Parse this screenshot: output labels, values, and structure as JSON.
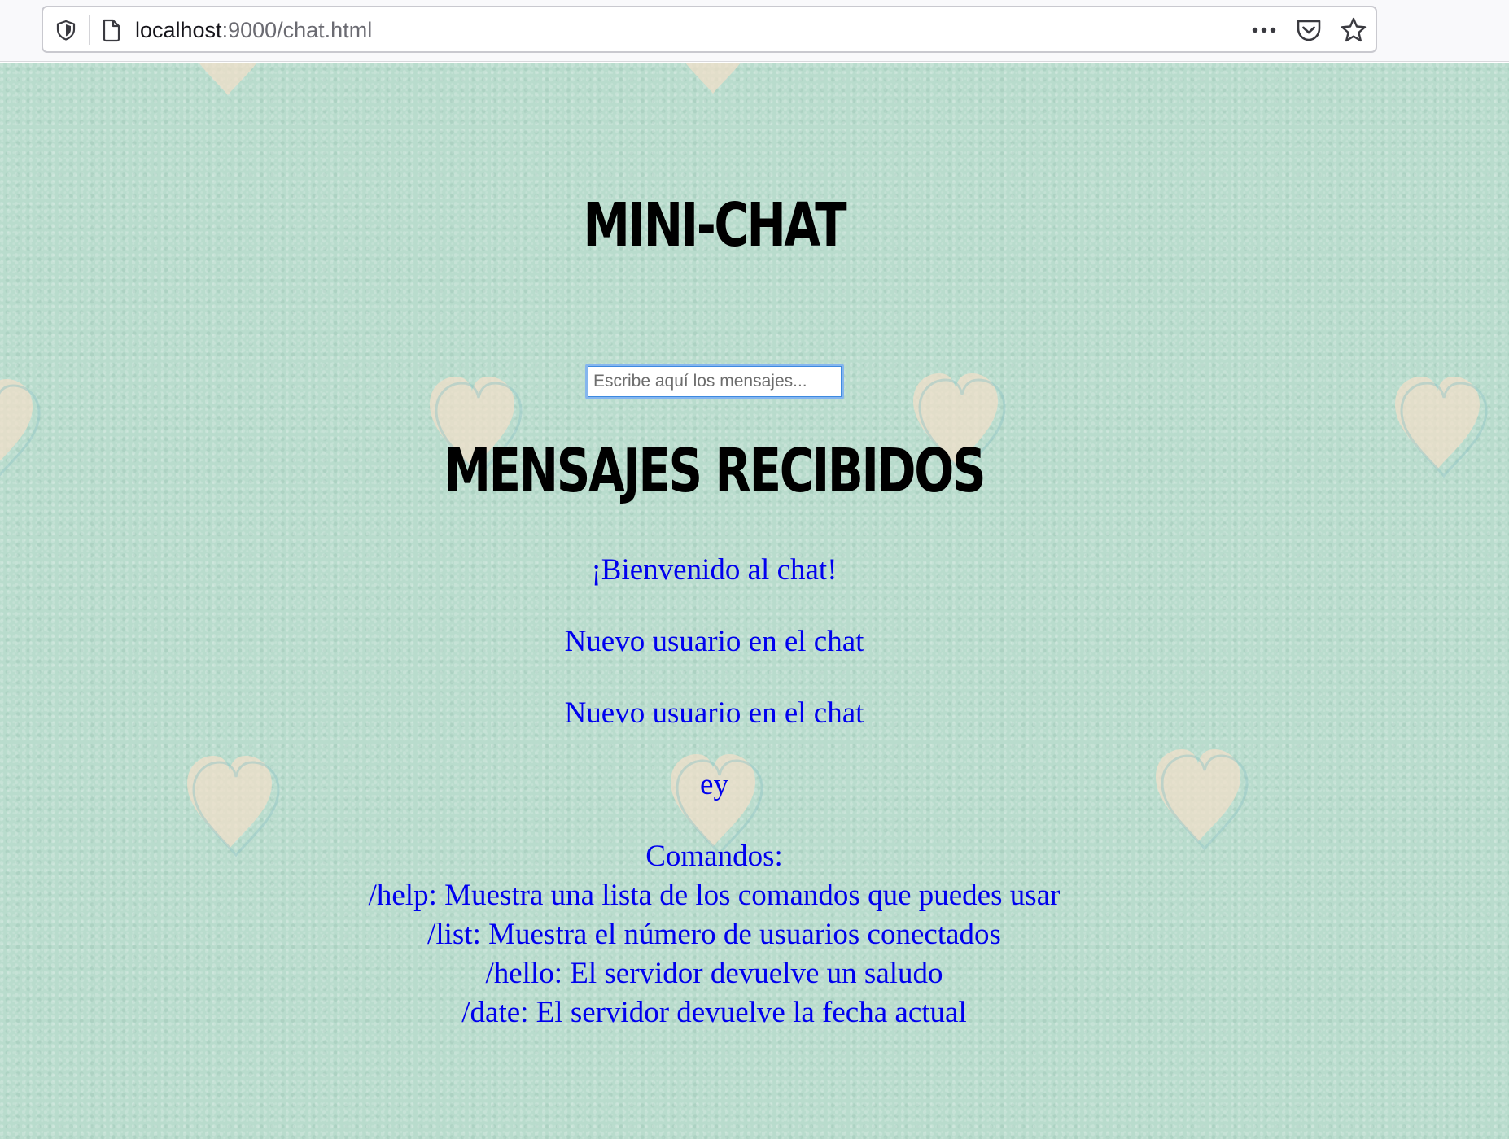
{
  "browser": {
    "url_host": "localhost",
    "url_rest": ":9000/chat.html"
  },
  "page": {
    "title": "MINI-CHAT",
    "input_placeholder": "Escribe aquí los mensajes...",
    "received_title": "MENSAJES RECIBIDOS",
    "messages": [
      "¡Bienvenido al chat!",
      "Nuevo usuario en el chat",
      "Nuevo usuario en el chat",
      "ey"
    ],
    "commands": {
      "heading": "Comandos:",
      "lines": [
        "/help: Muestra una lista de los comandos que puedes usar",
        "/list: Muestra el número de usuarios conectados",
        "/hello: El servidor devuelve un saludo",
        "/date: El servidor devuelve la fecha actual"
      ]
    }
  },
  "colors": {
    "background": "#b9dccd",
    "message_text": "#0000ee",
    "heart": "#f3dfc9"
  }
}
